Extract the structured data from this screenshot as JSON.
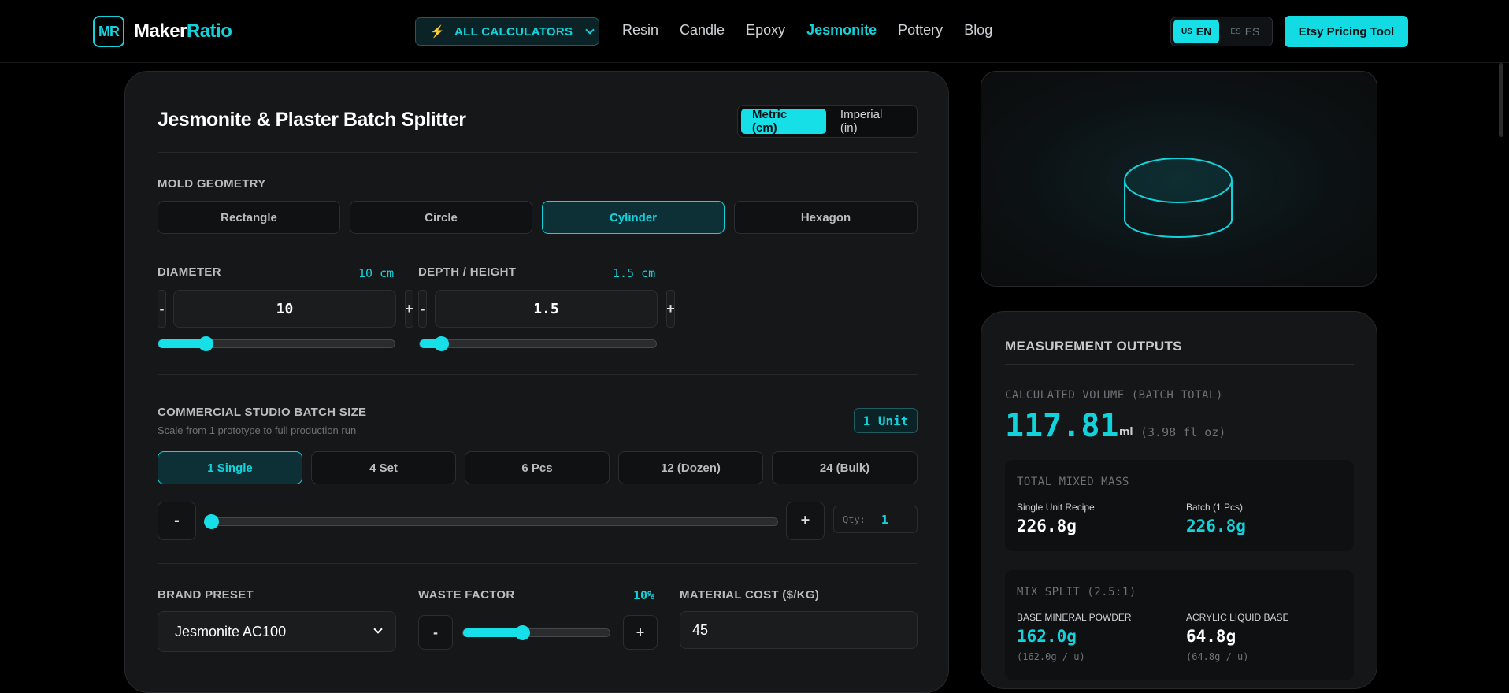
{
  "nav": {
    "logo_mark": "MR",
    "logo_main": "Maker",
    "logo_accent": "Ratio",
    "all_calculators": "ALL CALCULATORS",
    "links": [
      "Resin",
      "Candle",
      "Epoxy",
      "Jesmonite",
      "Pottery",
      "Blog"
    ],
    "active_link": "Jesmonite",
    "lang_en": {
      "flag": "US",
      "code": "EN"
    },
    "lang_es": {
      "flag": "ES",
      "code": "ES"
    },
    "etsy_button": "Etsy Pricing Tool"
  },
  "calculator": {
    "title": "Jesmonite & Plaster Batch Splitter",
    "units": [
      "Metric (cm)",
      "Imperial (in)"
    ],
    "selected_unit": "Metric (cm)",
    "mold_geometry_label": "MOLD GEOMETRY",
    "shapes": [
      "Rectangle",
      "Circle",
      "Cylinder",
      "Hexagon"
    ],
    "selected_shape": "Cylinder",
    "diameter": {
      "label": "DIAMETER",
      "tag": "10 cm",
      "value": "10",
      "minus": "-",
      "plus": "+",
      "slider_fraction": 0.2
    },
    "depth": {
      "label": "DEPTH / HEIGHT",
      "tag": "1.5 cm",
      "value": "1.5",
      "minus": "-",
      "plus": "+",
      "slider_fraction": 0.09
    },
    "batch": {
      "label": "COMMERCIAL STUDIO BATCH SIZE",
      "sublabel": "Scale from 1 prototype to full production run",
      "badge": "1 Unit",
      "options": [
        "1 Single",
        "4 Set",
        "6 Pcs",
        "12 (Dozen)",
        "24 (Bulk)"
      ],
      "selected": "1 Single",
      "minus": "-",
      "plus": "+",
      "qty_label": "Qty:",
      "qty_value": "1",
      "slider_fraction": 0.0
    },
    "brand": {
      "label": "BRAND PRESET",
      "selected": "Jesmonite AC100"
    },
    "waste": {
      "label": "WASTE FACTOR",
      "value": "10%",
      "minus": "-",
      "plus": "+",
      "slider_fraction": 0.4
    },
    "cost": {
      "label": "MATERIAL COST ($/KG)",
      "value": "45"
    }
  },
  "outputs": {
    "title": "MEASUREMENT OUTPUTS",
    "volume_label": "CALCULATED VOLUME (BATCH TOTAL)",
    "volume_value": "117.81",
    "volume_unit": "ml",
    "volume_alt": "(3.98 fl oz)",
    "mass": {
      "label": "TOTAL MIXED MASS",
      "single_caption": "Single Unit Recipe",
      "single_value": "226.8g",
      "batch_caption": "Batch (1 Pcs)",
      "batch_value": "226.8g"
    },
    "split": {
      "label": "MIX SPLIT (2.5:1)",
      "powder_caption": "BASE MINERAL POWDER",
      "powder_value": "162.0g",
      "powder_per": "(162.0g / u)",
      "liquid_caption": "ACRYLIC LIQUID BASE",
      "liquid_value": "64.8g",
      "liquid_per": "(64.8g / u)"
    }
  },
  "colors": {
    "accent": "#12d3dc",
    "bolt": "#ff9a3d",
    "background": "#000000",
    "card": "#161719"
  },
  "icons": [
    "logo-icon",
    "bolt-icon",
    "chevron-down-icon",
    "cylinder-icon"
  ]
}
